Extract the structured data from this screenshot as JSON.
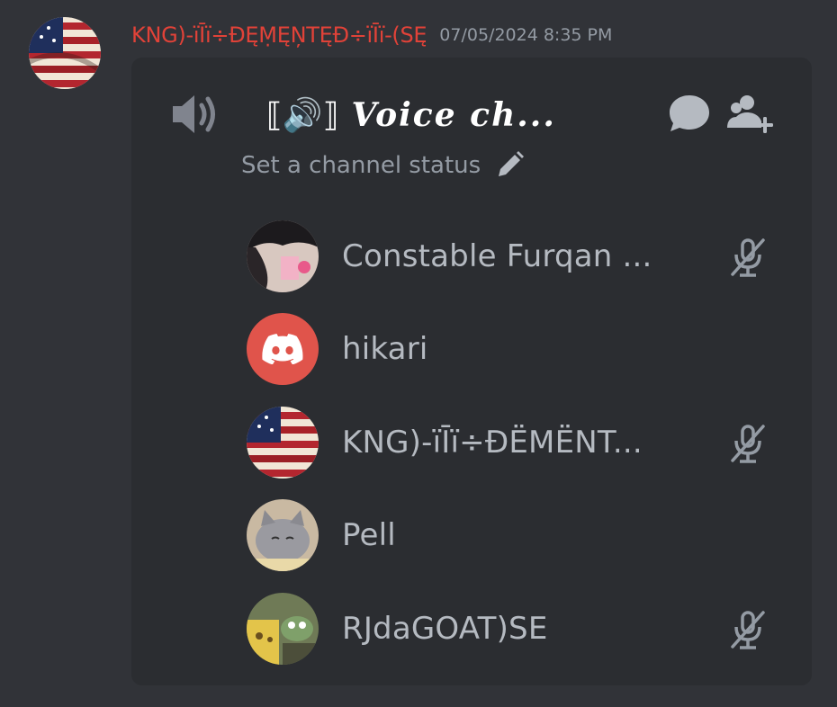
{
  "message": {
    "author": "KNG)-ïĪï÷ĐĘṂĘŅTĘĐ÷ïĪï-(SĘ",
    "timestamp": "07/05/2024 8:35 PM"
  },
  "voice_channel": {
    "prefix": "⟦🔊⟧",
    "name": "Voice ch...",
    "status_placeholder": "Set a channel status",
    "icons": [
      "speaker-icon",
      "chat-bubble-icon",
      "add-user-icon",
      "pencil-icon"
    ]
  },
  "members": [
    {
      "name": "Constable Furqan ...",
      "muted": true,
      "avatar": "anime-avatar"
    },
    {
      "name": "hikari",
      "muted": false,
      "avatar": "discord-default-avatar"
    },
    {
      "name": "KNG)-ïĪï÷ĐËMËNT...",
      "muted": true,
      "avatar": "flag-avatar"
    },
    {
      "name": "Pell",
      "muted": false,
      "avatar": "cat-avatar"
    },
    {
      "name": "RJdaGOAT)SE",
      "muted": true,
      "avatar": "meme-avatar"
    }
  ],
  "colors": {
    "background": "#313338",
    "embed": "#2b2d31",
    "author": "#e14238",
    "muted_text": "#949ba4",
    "member_text": "#b5bac1",
    "discord_avatar": "#e0544b"
  }
}
